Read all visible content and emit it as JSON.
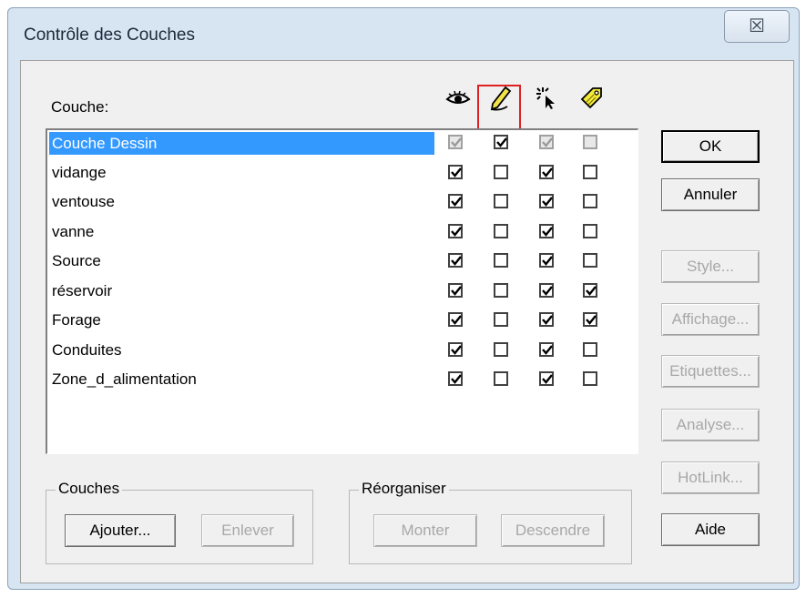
{
  "window": {
    "title": "Contrôle des Couches",
    "close_glyph": "☒"
  },
  "list_header": {
    "label": "Couche:",
    "columns": [
      {
        "icon": "eye-icon"
      },
      {
        "icon": "pencil-icon"
      },
      {
        "icon": "cursor-select-icon"
      },
      {
        "icon": "tag-icon"
      }
    ]
  },
  "layers": [
    {
      "name": "Couche Dessin",
      "selected": true,
      "visible": true,
      "editable": true,
      "selectable": true,
      "labels": false,
      "disabled": [
        true,
        false,
        true,
        true
      ]
    },
    {
      "name": "vidange",
      "visible": true,
      "editable": false,
      "selectable": true,
      "labels": false
    },
    {
      "name": "ventouse",
      "visible": true,
      "editable": false,
      "selectable": true,
      "labels": false
    },
    {
      "name": "vanne",
      "visible": true,
      "editable": false,
      "selectable": true,
      "labels": false
    },
    {
      "name": "Source",
      "visible": true,
      "editable": false,
      "selectable": true,
      "labels": false
    },
    {
      "name": "réservoir",
      "visible": true,
      "editable": false,
      "selectable": true,
      "labels": true
    },
    {
      "name": "Forage",
      "visible": true,
      "editable": false,
      "selectable": true,
      "labels": true
    },
    {
      "name": "Conduites",
      "visible": true,
      "editable": false,
      "selectable": true,
      "labels": false
    },
    {
      "name": "Zone_d_alimentation",
      "visible": true,
      "editable": false,
      "selectable": true,
      "labels": false
    }
  ],
  "side_buttons": {
    "ok": "OK",
    "cancel": "Annuler",
    "style": "Style...",
    "display": "Affichage...",
    "labels": "Etiquettes...",
    "analysis": "Analyse...",
    "hotlink": "HotLink...",
    "help": "Aide"
  },
  "layers_group": {
    "legend": "Couches",
    "add": "Ajouter...",
    "remove": "Enlever"
  },
  "reorder_group": {
    "legend": "Réorganiser",
    "up": "Monter",
    "down": "Descendre"
  }
}
